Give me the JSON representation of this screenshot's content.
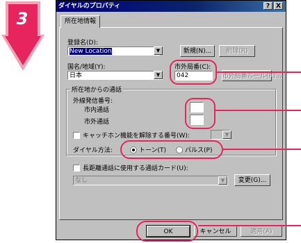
{
  "step": {
    "number": "3",
    "color": "#e8245e"
  },
  "window": {
    "title": "ダイヤルのプロパティ",
    "help_button": "?",
    "close_button": "X"
  },
  "tabs": [
    {
      "label": "所在地情報"
    }
  ],
  "location_name": {
    "label": "登録名(D):",
    "value": "New Location",
    "new_button": "新規(N)...",
    "delete_button": "削除(R)"
  },
  "country": {
    "label": "国名/地域(Y):",
    "value": "日本"
  },
  "area_code": {
    "label": "市外局番(C):",
    "value": "042",
    "rules_button": "市外局番ルール(R)..."
  },
  "dialing": {
    "group_title": "所在地からの通話",
    "outside_line_label": "外線発信番号:",
    "local_label": "市内通話",
    "local_value": "",
    "long_distance_label": "市外通話",
    "long_distance_value": "",
    "call_waiting_label": "キャッチホン機能を解除する番号(W):",
    "call_waiting_value": "",
    "dial_method_label": "ダイヤル方法:",
    "tone_label": "トーン(T)",
    "pulse_label": "パルス(P)",
    "selected": "tone"
  },
  "calling_card": {
    "label": "長距離通話に使用する通話カード(U):",
    "value": "なし",
    "change_button": "変更(G)..."
  },
  "footer": {
    "ok_button": "OK",
    "cancel_button": "キャンセル",
    "apply_button": "適用(A)"
  }
}
